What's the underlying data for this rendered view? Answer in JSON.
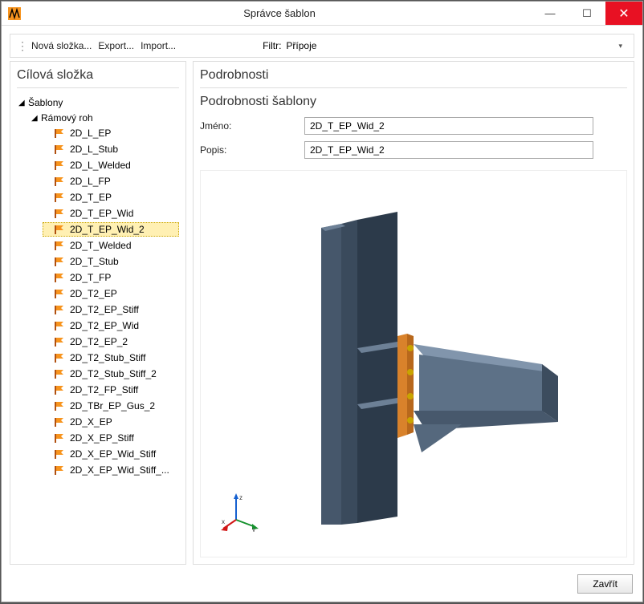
{
  "window": {
    "title": "Správce šablon"
  },
  "toolbar": {
    "new_folder": "Nová složka...",
    "export": "Export...",
    "import": "Import...",
    "filter_label": "Filtr:",
    "filter_value": "Přípoje"
  },
  "left": {
    "header": "Cílová složka",
    "root": "Šablony",
    "group": "Rámový roh",
    "items": [
      "2D_L_EP",
      "2D_L_Stub",
      "2D_L_Welded",
      "2D_L_FP",
      "2D_T_EP",
      "2D_T_EP_Wid",
      "2D_T_EP_Wid_2",
      "2D_T_Welded",
      "2D_T_Stub",
      "2D_T_FP",
      "2D_T2_EP",
      "2D_T2_EP_Stiff",
      "2D_T2_EP_Wid",
      "2D_T2_EP_2",
      "2D_T2_Stub_Stiff",
      "2D_T2_Stub_Stiff_2",
      "2D_T2_FP_Stiff",
      "2D_TBr_EP_Gus_2",
      "2D_X_EP",
      "2D_X_EP_Stiff",
      "2D_X_EP_Wid_Stiff",
      "2D_X_EP_Wid_Stiff_..."
    ],
    "selected_index": 6
  },
  "right": {
    "header": "Podrobnosti",
    "sub_header": "Podrobnosti šablony",
    "name_label": "Jméno:",
    "name_value": "2D_T_EP_Wid_2",
    "desc_label": "Popis:",
    "desc_value": "2D_T_EP_Wid_2"
  },
  "footer": {
    "close": "Zavřít"
  }
}
